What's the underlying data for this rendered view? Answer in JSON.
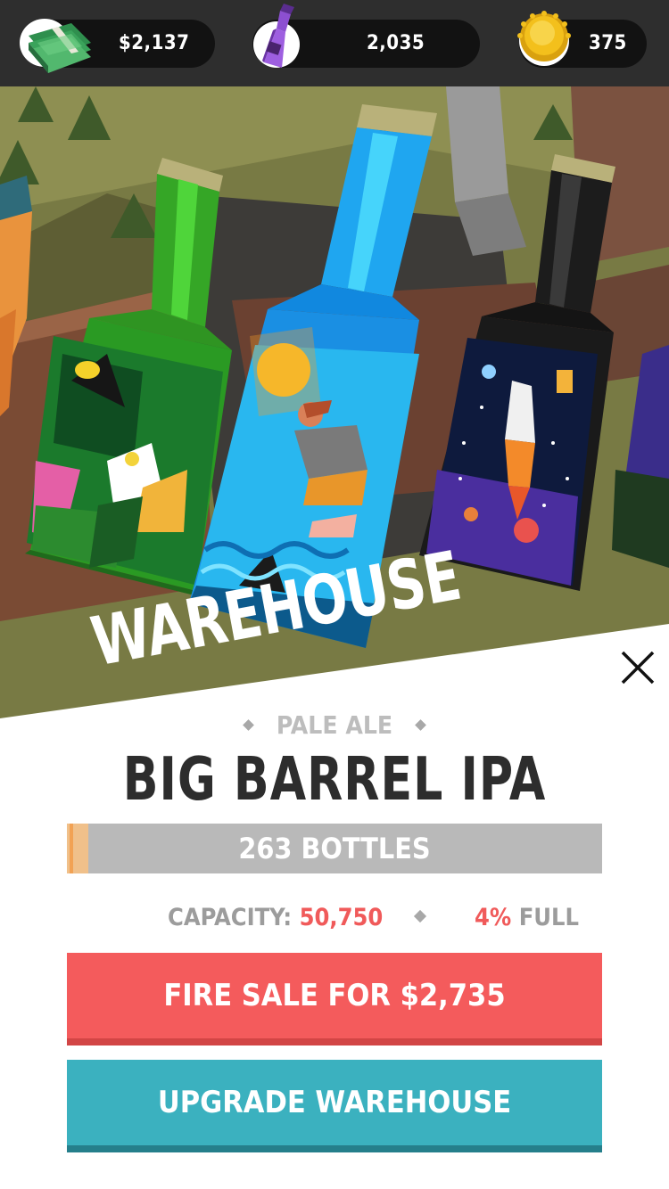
{
  "hud": {
    "cash": {
      "value": "$2,137",
      "icon": "cash-stack-icon"
    },
    "bottles": {
      "value": "2,035",
      "icon": "purple-bottle-icon"
    },
    "caps": {
      "value": "375",
      "icon": "gold-bottle-cap-icon"
    }
  },
  "panel": {
    "title": "WAREHOUSE",
    "style": "PALE ALE",
    "beer_name": "BIG BARREL IPA",
    "stock": {
      "label": "263 BOTTLES",
      "fill_fraction": 0.04
    },
    "capacity_label": "CAPACITY:",
    "capacity_value": "50,750",
    "percent_value": "4%",
    "percent_label": "FULL",
    "fire_sale_label": "FIRE SALE FOR $2,735",
    "upgrade_label": "UPGRADE WAREHOUSE"
  },
  "colors": {
    "accent_red": "#f45b5c",
    "accent_teal": "#3bb1bf",
    "hud_bg": "#2e2e2e"
  }
}
